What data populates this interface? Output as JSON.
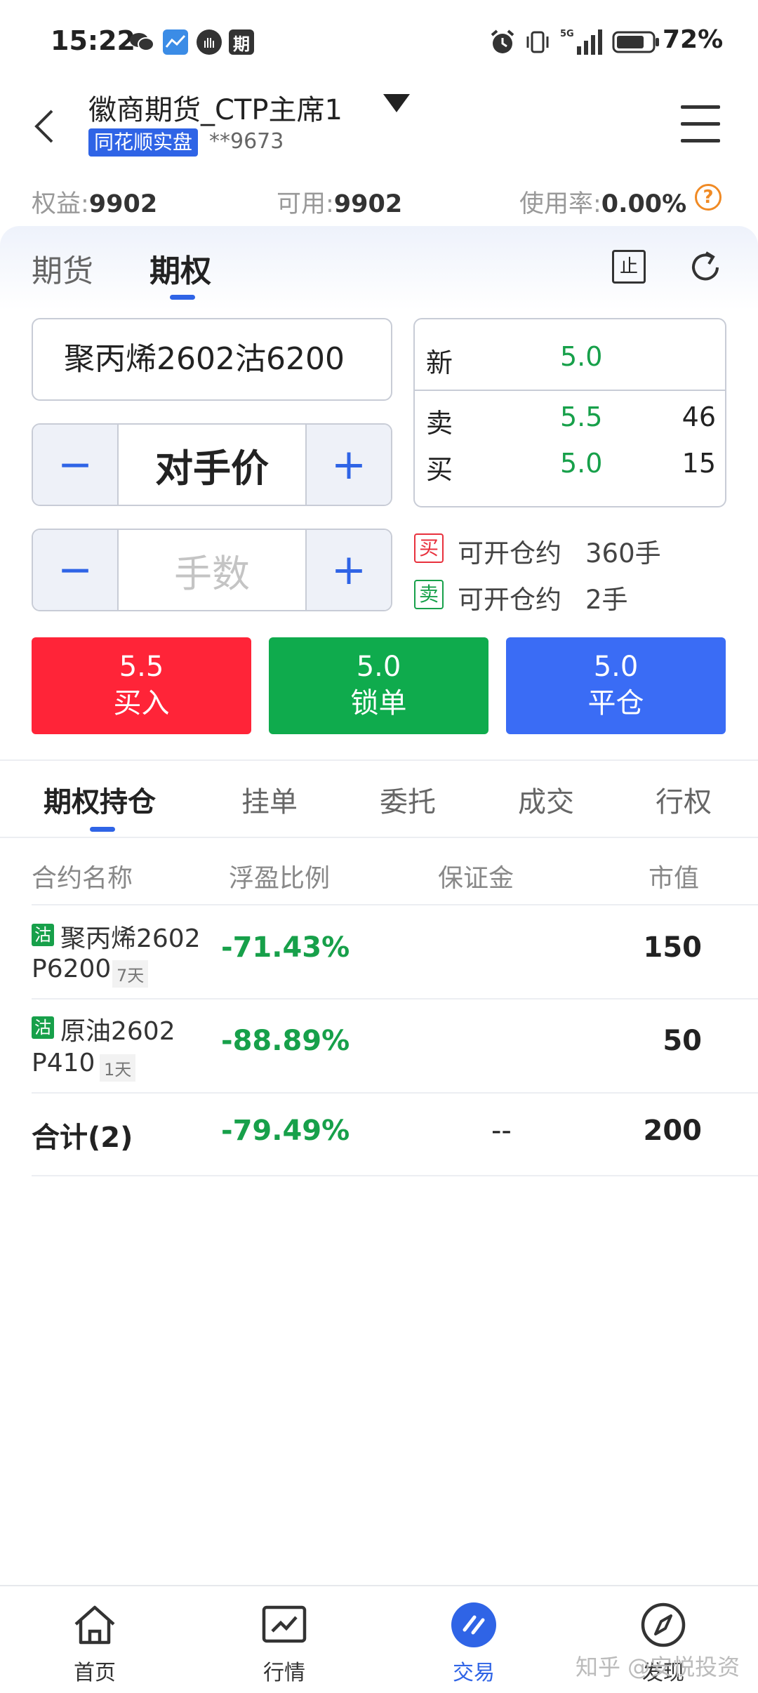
{
  "status_bar": {
    "time": "15:22",
    "battery": "72%",
    "notif_badge_text": "期",
    "network": "5G"
  },
  "header": {
    "account_name": "徽商期货_CTP主席1",
    "badge": "同花顺实盘",
    "account_no": "**9673"
  },
  "summary": {
    "equity_label": "权益:",
    "equity_value": "9902",
    "available_label": "可用:",
    "available_value": "9902",
    "usage_label": "使用率:",
    "usage_value": "0.00%"
  },
  "top_tabs": [
    "期货",
    "期权"
  ],
  "stop_icon_text": "止",
  "order": {
    "contract": "聚丙烯2602沽6200",
    "price_type": "对手价",
    "qty_placeholder": "手数",
    "minus": "−",
    "plus": "+"
  },
  "quote": {
    "last_label": "新",
    "last_value": "5.0",
    "ask_label": "卖",
    "ask_value": "5.5",
    "ask_vol": "46",
    "bid_label": "买",
    "bid_value": "5.0",
    "bid_vol": "15"
  },
  "avail": {
    "buy_tag": "买",
    "buy_text": "可开仓约",
    "buy_qty": "360手",
    "sell_tag": "卖",
    "sell_text": "可开仓约",
    "sell_qty": "2手"
  },
  "actions": [
    {
      "price": "5.5",
      "label": "买入",
      "color": "#ff2438"
    },
    {
      "price": "5.0",
      "label": "锁单",
      "color": "#0fab4d"
    },
    {
      "price": "5.0",
      "label": "平仓",
      "color": "#3a6cf5"
    }
  ],
  "sub_tabs": [
    "期权持仓",
    "挂单",
    "委托",
    "成交",
    "行权"
  ],
  "table": {
    "headers": [
      "合约名称",
      "浮盈比例",
      "保证金",
      "市值"
    ],
    "rows": [
      {
        "tag": "沽",
        "name": "聚丙烯2602",
        "code": "P6200",
        "days": "7天",
        "pct": "-71.43%",
        "margin": "",
        "value": "150"
      },
      {
        "tag": "沽",
        "name": "原油2602",
        "code": "P410",
        "days": "1天",
        "pct": "-88.89%",
        "margin": "",
        "value": "50"
      }
    ],
    "total": {
      "label": "合计(2)",
      "pct": "-79.49%",
      "margin": "--",
      "value": "200"
    }
  },
  "bottom_nav": [
    {
      "label": "首页",
      "icon": "home-icon"
    },
    {
      "label": "行情",
      "icon": "chart-icon"
    },
    {
      "label": "交易",
      "icon": "trade-icon",
      "active": true
    },
    {
      "label": "发现",
      "icon": "compass-icon"
    }
  ],
  "watermark": "知乎 @安悦投资",
  "colors": {
    "accent": "#2f64e6",
    "green": "#17a04a",
    "red": "#e8313d"
  }
}
